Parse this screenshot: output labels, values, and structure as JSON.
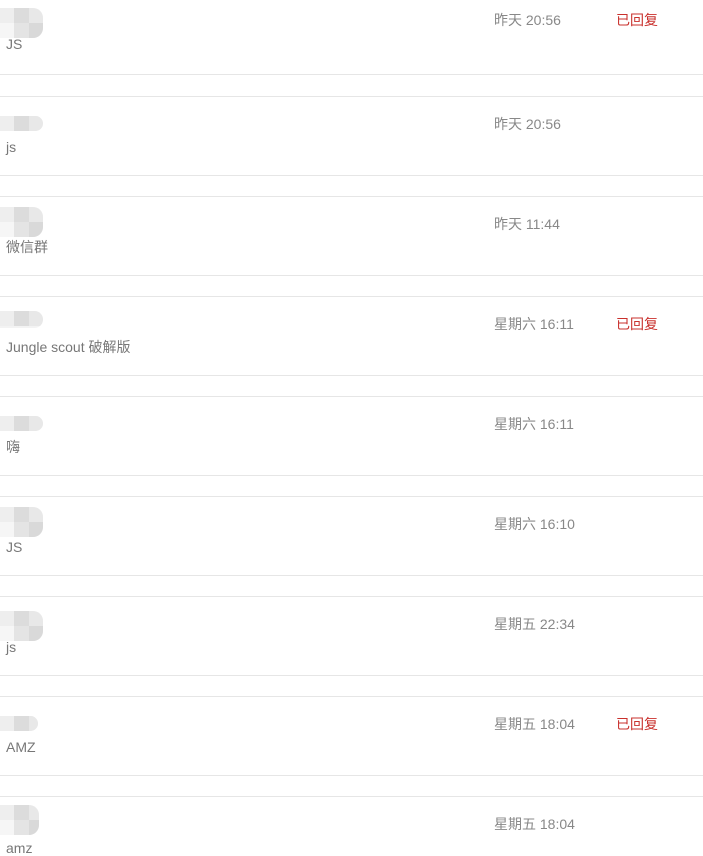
{
  "messages": [
    {
      "text": "JS",
      "time": "昨天 20:56",
      "status": "已回复"
    },
    {
      "text": "js",
      "time": "昨天 20:56",
      "status": ""
    },
    {
      "text": "微信群",
      "time": "昨天 11:44",
      "status": ""
    },
    {
      "text": "Jungle scout 破解版",
      "time": "星期六 16:11",
      "status": "已回复"
    },
    {
      "text": "嗨",
      "time": "星期六 16:11",
      "status": ""
    },
    {
      "text": "JS",
      "time": "星期六 16:10",
      "status": ""
    },
    {
      "text": "js",
      "time": "星期五 22:34",
      "status": ""
    },
    {
      "text": "AMZ",
      "time": "星期五 18:04",
      "status": "已回复"
    },
    {
      "text": "amz",
      "time": "星期五 18:04",
      "status": ""
    }
  ]
}
